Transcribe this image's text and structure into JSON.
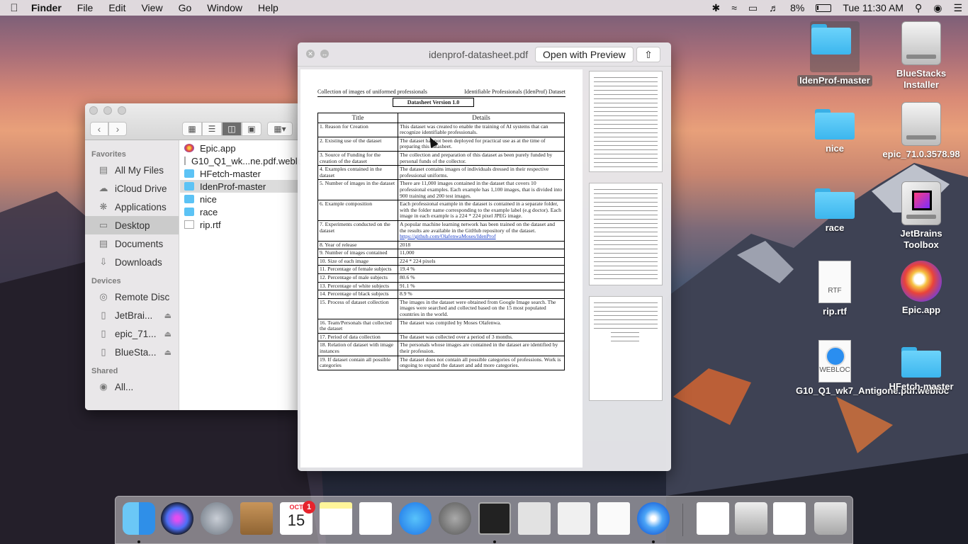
{
  "menubar": {
    "app_name": "Finder",
    "menus": [
      "File",
      "Edit",
      "View",
      "Go",
      "Window",
      "Help"
    ],
    "battery": "8%",
    "clock": "Tue 11:30 AM"
  },
  "desktop_icons": [
    {
      "label": "IdenProf-master",
      "type": "folder"
    },
    {
      "label": "BlueStacks Installer",
      "type": "drive"
    },
    {
      "label": "nice",
      "type": "folder"
    },
    {
      "label": "epic_71.0.3578.98",
      "type": "drive"
    },
    {
      "label": "race",
      "type": "folder"
    },
    {
      "label": "JetBrains Toolbox",
      "type": "app"
    },
    {
      "label": "rip.rtf",
      "type": "rtf",
      "badge": "RTF"
    },
    {
      "label": "Epic.app",
      "type": "app"
    },
    {
      "label": "G10_Q1_wk7_Antigone.pdf.webloc",
      "type": "webloc",
      "badge": "WEBLOC"
    },
    {
      "label": "HFetch-master",
      "type": "folder"
    }
  ],
  "finder": {
    "sidebar": {
      "favorites_header": "Favorites",
      "favorites": [
        "All My Files",
        "iCloud Drive",
        "Applications",
        "Desktop",
        "Documents",
        "Downloads"
      ],
      "devices_header": "Devices",
      "devices": [
        "Remote Disc",
        "JetBrai...",
        "epic_71...",
        "BlueSta..."
      ],
      "shared_header": "Shared",
      "shared": [
        "All..."
      ]
    },
    "files": [
      "Epic.app",
      "G10_Q1_wk...ne.pdf.webloc",
      "HFetch-master",
      "IdenProf-master",
      "nice",
      "race",
      "rip.rtf"
    ]
  },
  "quicklook": {
    "filename": "idenprof-datasheet.pdf",
    "open_button": "Open with Preview",
    "share_icon": "share-icon",
    "page": {
      "left_header": "Collection of images of uniformed professionals",
      "right_header": "Identifiable Professionals (IdenProf) Dataset",
      "version": "Datasheet Version 1.0",
      "col_title": "Title",
      "col_details": "Details",
      "rows": [
        [
          "1. Reason for Creation",
          "This dataset was created to enable the training of AI systems that can recognize identifiable professionals."
        ],
        [
          "2. Existing use of the dataset",
          "The dataset has not been deployed  for practical use as at the time of preparing this datasheet."
        ],
        [
          "3. Source of Funding for the creation of the dataset",
          "The collection and preparation of this dataset as been purely funded by personal funds of the collector."
        ],
        [
          "4. Examples contained in the dataset",
          "The dataset contains images of individuals dressed in their respective professional uniforms."
        ],
        [
          "5. Number of images in the dataset",
          "There are 11,000 images contained in the dataset that covers 10 professional examples. Each example has 1,100 images, that is divided into 900 training and 200 test images."
        ],
        [
          "6. Example composition",
          "Each professional example in the dataset is contained in a separate folder, with the folder name corresponding to the example label (e.g doctor). Each image in each example is a 224 * 224 pixel JPEG image."
        ],
        [
          "7. Experiments conducted on the dataset",
          "A popular machine learning network has been trained on the dataset and the results are available in the GitHub repository of the dataset."
        ],
        [
          "8. Year of release",
          "2018"
        ],
        [
          "9. Number of images contained",
          "11,000"
        ],
        [
          "10. Size of each image",
          "224 * 224 pixels"
        ],
        [
          "11. Percentage of female subjects",
          "19.4 %"
        ],
        [
          "12. Percentage of male subjects",
          "80.6 %"
        ],
        [
          "13. Percentage of white subjects",
          "91.1 %"
        ],
        [
          "14. Percentage of black subjects",
          "8.9 %"
        ],
        [
          "15. Process of dataset collection",
          "The images in the dataset were obtained from Google Image search. The images were searched and collected based on the 15 most populated countries in the world."
        ],
        [
          "16. Team/Personals that collected the dataset",
          "The dataset was compiled by Moses Olafenwa."
        ],
        [
          "17. Period of data collection",
          "The dataset was collected over a period of 3 months."
        ],
        [
          "18. Relation of dataset with image instances",
          "The personals whose images are contained in the dataset are identified by their profession."
        ],
        [
          "19. If dataset contain all possible categories",
          "The dataset does not contain all possible categories of professions. Work is ongoing to expand the dataset and add more categories."
        ]
      ],
      "link": "https://github.com/OlafenwaMoses/IdenProf"
    }
  },
  "dock": {
    "apps": [
      "Finder",
      "Siri",
      "Launchpad",
      "Contacts",
      "Calendar",
      "Notes",
      "Reminders",
      "App Store",
      "System Preferences",
      "Terminal",
      "Script Editor",
      "Activity Monitor",
      "TextEdit",
      "Safari",
      "Document",
      "Help Viewer",
      "Screenshot",
      "Trash"
    ],
    "calendar_month": "OCT",
    "calendar_day": "15",
    "calendar_badge": "1"
  }
}
